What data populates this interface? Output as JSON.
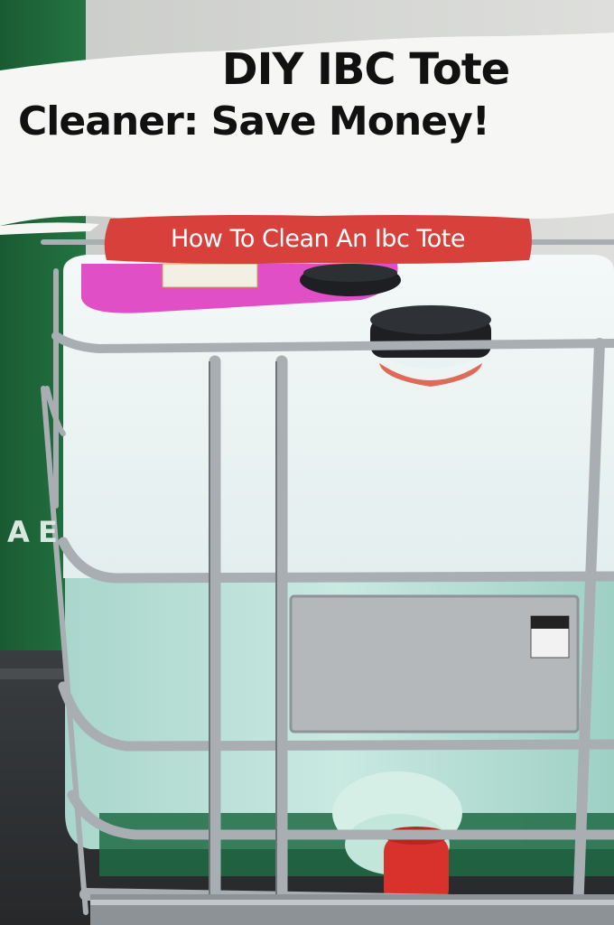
{
  "title": {
    "line1": "DIY IBC Tote",
    "line2": "Cleaner: Save Money!"
  },
  "subtitle": "How To Clean An Ibc Tote",
  "colors": {
    "title_band": "#f6f6f5",
    "banner_red": "#d8403c",
    "sign_green": "#1f6b3a",
    "tank_white": "#eef5f5",
    "tank_teal": "#bfe3da",
    "cage_steel": "#a9aeb2",
    "cap_black": "#1d1f22",
    "valve_red": "#d9312c"
  },
  "sign_letters": [
    "A",
    "E"
  ]
}
